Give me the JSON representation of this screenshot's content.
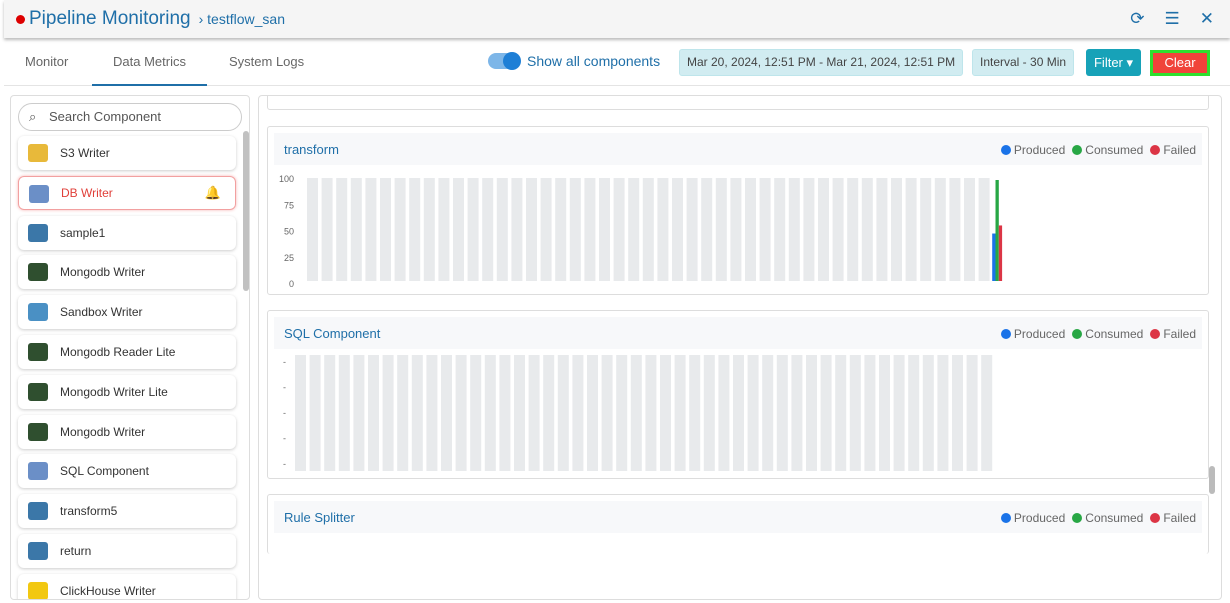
{
  "header": {
    "title": "Pipeline Monitoring",
    "breadcrumb": "testflow_san"
  },
  "tabs": [
    "Monitor",
    "Data Metrics",
    "System Logs"
  ],
  "toolbar": {
    "show_all": "Show all components",
    "date_range": "Mar 20, 2024, 12:51 PM - Mar 21, 2024, 12:51 PM",
    "interval": "Interval - 30 Min",
    "filter": "Filter",
    "clear": "Clear"
  },
  "sidebar": {
    "search_placeholder": "Search Component",
    "items": [
      {
        "label": "S3 Writer",
        "icon": "s3",
        "color": "#e8b93a"
      },
      {
        "label": "DB Writer",
        "icon": "db",
        "color": "#6b8fc7"
      },
      {
        "label": "sample1",
        "icon": "python",
        "color": "#3b77a8"
      },
      {
        "label": "Mongodb Writer",
        "icon": "mongodb",
        "color": "#2f4f2f"
      },
      {
        "label": "Sandbox Writer",
        "icon": "sandbox",
        "color": "#4a90c4"
      },
      {
        "label": "Mongodb Reader Lite",
        "icon": "mongodb",
        "color": "#2f4f2f"
      },
      {
        "label": "Mongodb Writer Lite",
        "icon": "mongodb",
        "color": "#2f4f2f"
      },
      {
        "label": "Mongodb Writer",
        "icon": "mongodb",
        "color": "#2f4f2f"
      },
      {
        "label": "SQL Component",
        "icon": "sql",
        "color": "#6b8fc7"
      },
      {
        "label": "transform5",
        "icon": "python",
        "color": "#3b77a8"
      },
      {
        "label": "return",
        "icon": "python",
        "color": "#3b77a8"
      },
      {
        "label": "ClickHouse Writer",
        "icon": "clickhouse",
        "color": "#f2c811"
      }
    ]
  },
  "legend": {
    "produced": "Produced",
    "consumed": "Consumed",
    "failed": "Failed"
  },
  "colors": {
    "produced": "#1a73e8",
    "consumed": "#28a745",
    "failed": "#dc3545"
  },
  "chart_data": [
    {
      "type": "bar",
      "title": "transform",
      "ylim": [
        0,
        100
      ],
      "yticks": [
        "100",
        "75",
        "50",
        "25",
        "0"
      ],
      "slots": 47,
      "series": [
        {
          "name": "Produced",
          "values_last": 47
        },
        {
          "name": "Consumed",
          "values_last": 100
        },
        {
          "name": "Failed",
          "values_last": 55
        }
      ]
    },
    {
      "type": "bar",
      "title": "SQL Component",
      "yticks": [
        "-",
        "-",
        "-",
        "-",
        "-"
      ],
      "slots": 48,
      "series": []
    },
    {
      "type": "bar",
      "title": "Rule Splitter",
      "series": []
    }
  ]
}
